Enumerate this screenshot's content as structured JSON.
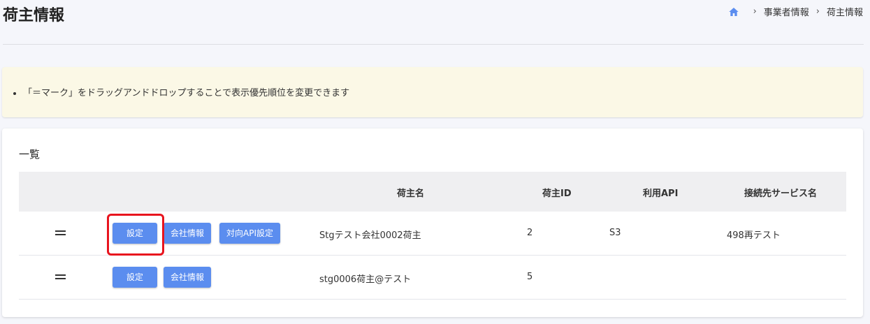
{
  "header": {
    "title": "荷主情報",
    "breadcrumb": [
      "事業者情報",
      "荷主情報"
    ]
  },
  "notice": {
    "text": "「＝マーク」をドラッグアンドドロップすることで表示優先順位を変更できます"
  },
  "list": {
    "title": "一覧",
    "columns": [
      "荷主名",
      "荷主ID",
      "利用API",
      "接続先サービス名"
    ],
    "rows": [
      {
        "buttons": [
          "設定",
          "会社情報",
          "対向API設定"
        ],
        "name": "Stgテスト会社0002荷主",
        "id": "2",
        "api": "S3",
        "service": "498再テスト"
      },
      {
        "buttons": [
          "設定",
          "会社情報"
        ],
        "name": "stg0006荷主@テスト",
        "id": "5",
        "api": "",
        "service": ""
      }
    ]
  },
  "colors": {
    "button": "#5b8def",
    "highlight": "#e8141e",
    "notice_bg": "#fbf8e6",
    "header_bg": "#efeff1"
  }
}
